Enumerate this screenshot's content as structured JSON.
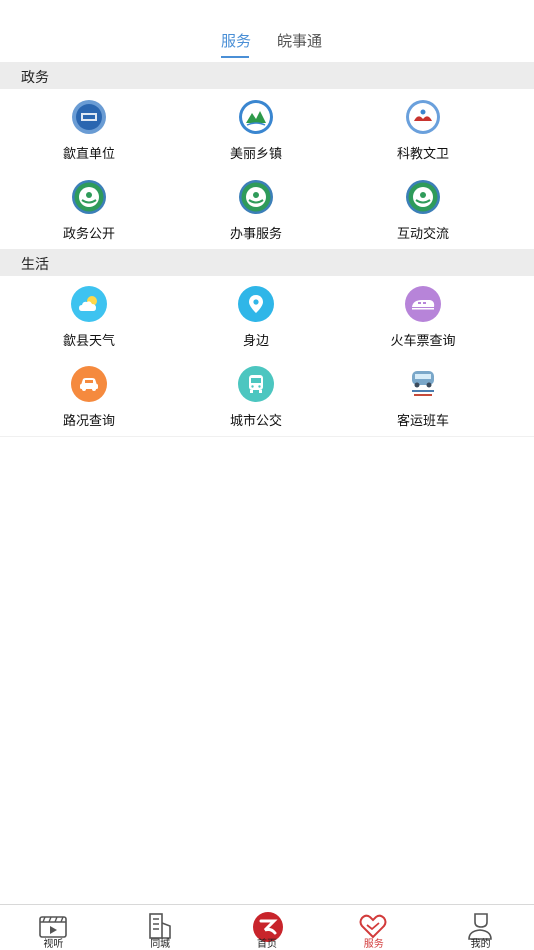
{
  "tabs": [
    {
      "label": "服务",
      "active": true
    },
    {
      "label": "皖事通",
      "active": false
    }
  ],
  "sections": [
    {
      "title": "政务",
      "items": [
        {
          "label": "歙直单位",
          "icon": "government-emblem-icon"
        },
        {
          "label": "美丽乡镇",
          "icon": "landscape-emblem-icon"
        },
        {
          "label": "科教文卫",
          "icon": "science-education-emblem-icon"
        },
        {
          "label": "政务公开",
          "icon": "green-emblem-icon"
        },
        {
          "label": "办事服务",
          "icon": "green-emblem-icon"
        },
        {
          "label": "互动交流",
          "icon": "green-emblem-icon"
        }
      ]
    },
    {
      "title": "生活",
      "items": [
        {
          "label": "歙县天气",
          "icon": "weather-icon",
          "color": "#3ec3f0"
        },
        {
          "label": "身边",
          "icon": "location-pin-icon",
          "color": "#2fb6e8"
        },
        {
          "label": "火车票查询",
          "icon": "train-icon",
          "color": "#b784d9"
        },
        {
          "label": "路况查询",
          "icon": "car-icon",
          "color": "#f58a3e"
        },
        {
          "label": "城市公交",
          "icon": "bus-icon",
          "color": "#4cc6c0"
        },
        {
          "label": "客运班车",
          "icon": "coach-bus-icon"
        }
      ]
    }
  ],
  "bottom_nav": [
    {
      "label": "视听",
      "icon": "video-icon",
      "active": false
    },
    {
      "label": "同城",
      "icon": "city-buildings-icon",
      "active": false
    },
    {
      "label": "首页",
      "icon": "home-logo-icon",
      "active": false
    },
    {
      "label": "服务",
      "icon": "heart-hand-icon",
      "active": true
    },
    {
      "label": "我的",
      "icon": "profile-icon",
      "active": false
    }
  ]
}
